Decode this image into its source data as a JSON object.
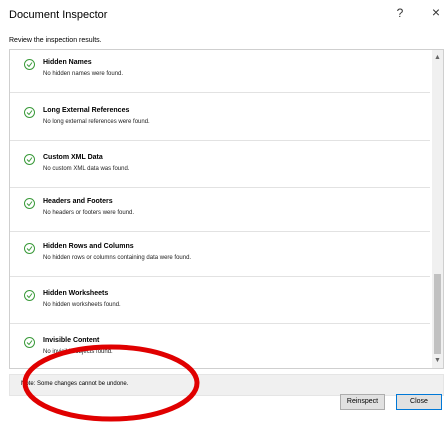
{
  "window": {
    "title": "Document Inspector",
    "help": "?",
    "close": "×"
  },
  "subtitle": "Review the inspection results.",
  "results": [
    {
      "title": "Hidden Names",
      "desc": "No hidden names were found."
    },
    {
      "title": "Long External References",
      "desc": "No long external references were found."
    },
    {
      "title": "Custom XML Data",
      "desc": "No custom XML data was found."
    },
    {
      "title": "Headers and Footers",
      "desc": "No headers or footers were found."
    },
    {
      "title": "Hidden Rows and Columns",
      "desc": "No hidden rows or columns containing data were found."
    },
    {
      "title": "Hidden Worksheets",
      "desc": "No hidden worksheets found."
    },
    {
      "title": "Invisible Content",
      "desc": "No invisible objects found."
    }
  ],
  "note": "Note: Some changes cannot be undone.",
  "buttons": {
    "reinspect": "Reinspect",
    "close": "Close"
  },
  "colors": {
    "check": "#3a9a3a",
    "annotation": "#e00000"
  }
}
